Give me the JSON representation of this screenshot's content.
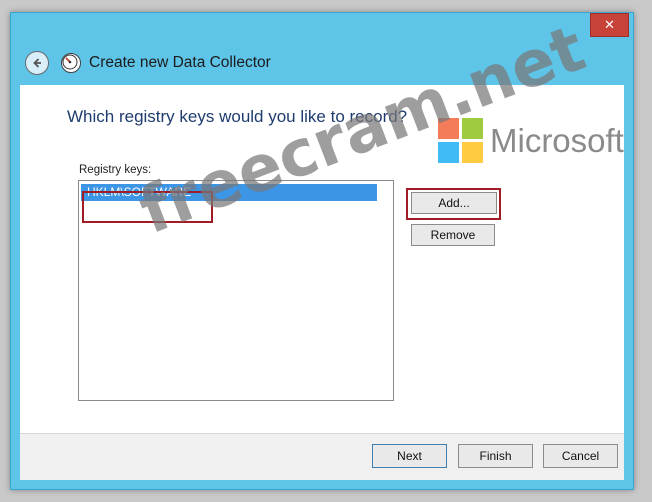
{
  "window": {
    "title": "Create new Data Collector",
    "close_glyph": "✕"
  },
  "page": {
    "heading": "Which registry keys would you like to record?",
    "list_label": "Registry keys:",
    "registry_keys": [
      "HKLM\\SOFTWARE"
    ]
  },
  "side_buttons": {
    "add": "Add...",
    "remove": "Remove"
  },
  "footer": {
    "next": "Next",
    "finish": "Finish",
    "cancel": "Cancel"
  },
  "overlay": {
    "logo_text": "Microsoft",
    "watermark": "freecram.net"
  },
  "colors": {
    "title_bar": "#5ec4e8",
    "selection": "#3d95e5",
    "highlight_box": "#a01c24",
    "close_button": "#c7433a"
  }
}
